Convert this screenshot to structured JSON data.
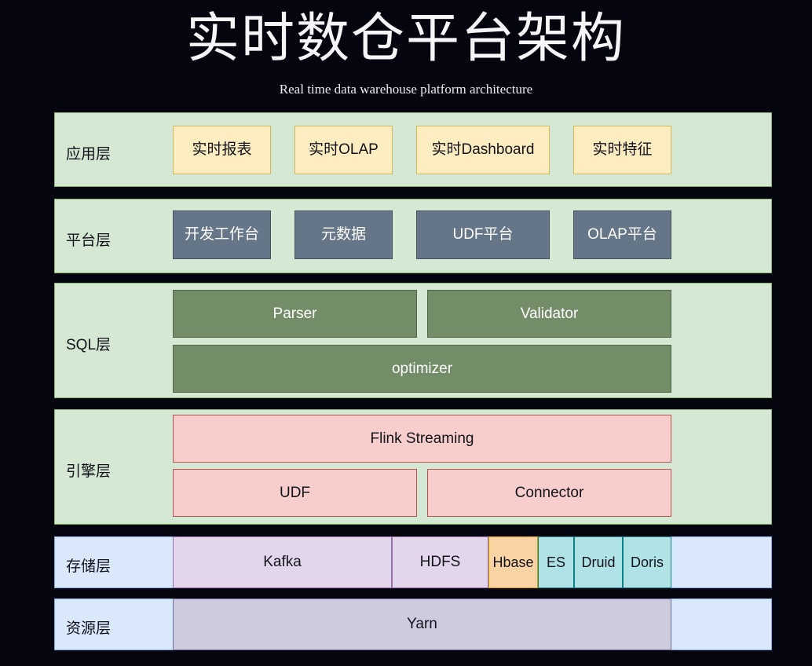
{
  "header": {
    "title": "实时数仓平台架构",
    "subtitle": "Real time data warehouse platform architecture"
  },
  "colors": {
    "background": "#05050f",
    "band_green_fill": "#d5e8d4",
    "band_green_border": "#82b366",
    "band_blue_fill": "#dae8fc",
    "band_blue_border": "#7ea6e0",
    "app_node_fill": "#ffedc2",
    "app_node_border": "#d6b656",
    "platform_node_fill": "#647687",
    "sql_node_fill": "#728d68",
    "engine_node_fill": "#f8cecc",
    "engine_node_border": "#b85450",
    "storage_purple_fill": "#e3d6ec",
    "storage_orange_fill": "#fad3a4",
    "storage_teal_fill": "#b0e3e6",
    "resource_lavender_fill": "#cdccdf"
  },
  "layers": [
    {
      "id": "application",
      "label": "应用层",
      "nodes": [
        {
          "label": "实时报表"
        },
        {
          "label": "实时OLAP"
        },
        {
          "label": "实时Dashboard"
        },
        {
          "label": "实时特征"
        }
      ]
    },
    {
      "id": "platform",
      "label": "平台层",
      "nodes": [
        {
          "label": "开发工作台"
        },
        {
          "label": "元数据"
        },
        {
          "label": "UDF平台"
        },
        {
          "label": "OLAP平台"
        }
      ]
    },
    {
      "id": "sql",
      "label": "SQL层",
      "nodes": [
        {
          "label": "Parser"
        },
        {
          "label": "Validator"
        },
        {
          "label": "optimizer"
        }
      ]
    },
    {
      "id": "engine",
      "label": "引擎层",
      "nodes": [
        {
          "label": "Flink Streaming"
        },
        {
          "label": "UDF"
        },
        {
          "label": "Connector"
        }
      ]
    },
    {
      "id": "storage",
      "label": "存储层",
      "nodes": [
        {
          "label": "Kafka"
        },
        {
          "label": "HDFS"
        },
        {
          "label": "Hbase"
        },
        {
          "label": "ES"
        },
        {
          "label": "Druid"
        },
        {
          "label": "Doris"
        }
      ]
    },
    {
      "id": "resource",
      "label": "资源层",
      "nodes": [
        {
          "label": "Yarn"
        }
      ]
    }
  ]
}
